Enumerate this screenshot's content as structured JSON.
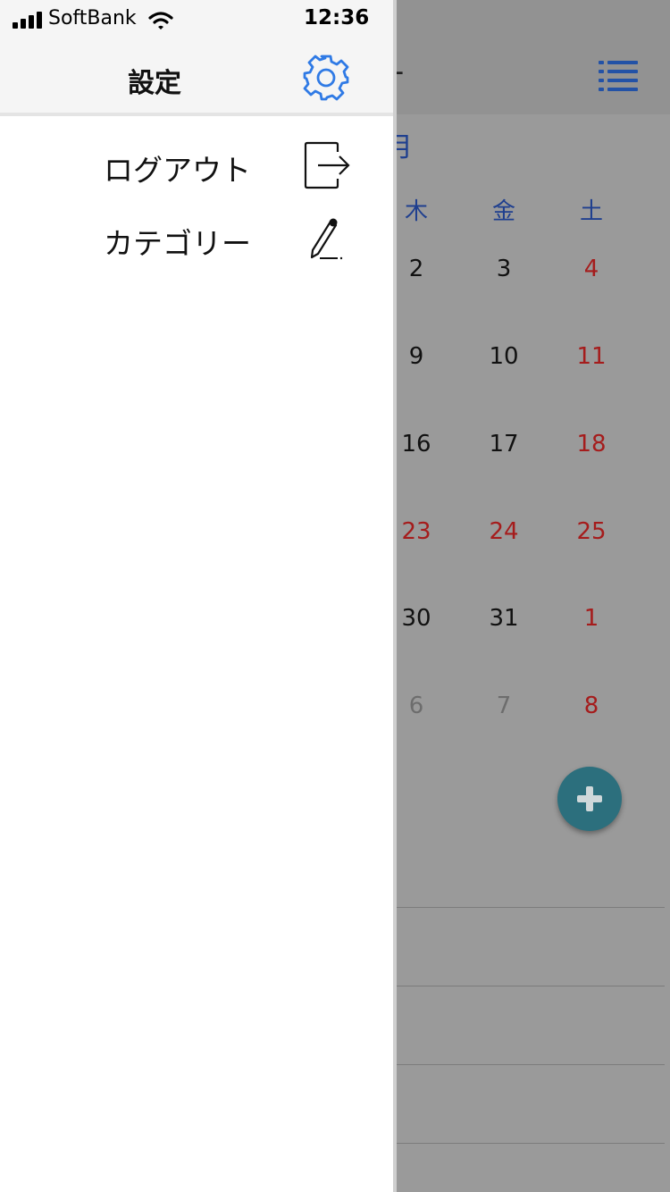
{
  "status_bar": {
    "carrier": "SoftBank",
    "time": "12:36",
    "signal_icon": "cellular-signal-icon",
    "wifi_icon": "wifi-icon"
  },
  "drawer": {
    "title": "設定",
    "header_icon": "gear-icon",
    "items": [
      {
        "label": "ログアウト",
        "icon": "logout-icon"
      },
      {
        "label": "カテゴリー",
        "icon": "pencil-icon"
      }
    ]
  },
  "background_calendar": {
    "title_fragment": "-",
    "month_fragment": "月",
    "menu_icon": "list-icon",
    "weekdays": [
      "木",
      "金",
      "土"
    ],
    "rows": [
      [
        "2",
        "3",
        "4"
      ],
      [
        "9",
        "10",
        "11"
      ],
      [
        "16",
        "17",
        "18"
      ],
      [
        "23",
        "24",
        "25"
      ],
      [
        "30",
        "31",
        "1"
      ],
      [
        "6",
        "7",
        "8"
      ]
    ],
    "add_icon": "plus-icon"
  },
  "colors": {
    "accent_blue": "#2f7ae5",
    "weekday_blue": "#1f3f8f",
    "holiday_red": "#a51c1c",
    "fab_teal": "#2c6f7d",
    "overlay_gray": "#9a9a9a"
  }
}
